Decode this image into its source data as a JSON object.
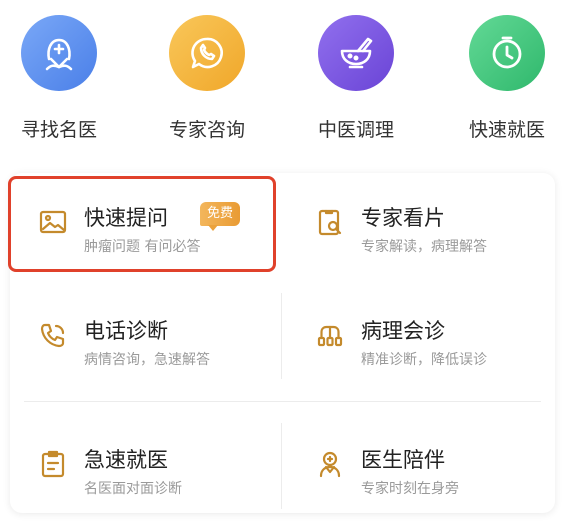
{
  "top_nav": [
    {
      "label": "寻找名医",
      "icon": "find-doctor-icon",
      "color": "#5b8ff1"
    },
    {
      "label": "专家咨询",
      "icon": "expert-consult-icon",
      "color": "#f5b63c"
    },
    {
      "label": "中医调理",
      "icon": "tcm-icon",
      "color": "#7b56e0"
    },
    {
      "label": "快速就医",
      "icon": "clock-icon",
      "color": "#3cc67a"
    }
  ],
  "services": [
    {
      "title": "快速提问",
      "subtitle": "肿瘤问题 有问必答",
      "badge": "免费",
      "icon": "picture-icon"
    },
    {
      "title": "专家看片",
      "subtitle": "专家解读，病理解答",
      "icon": "film-review-icon"
    },
    {
      "title": "电话诊断",
      "subtitle": "病情咨询，急速解答",
      "icon": "phone-icon"
    },
    {
      "title": "病理会诊",
      "subtitle": "精准诊断，降低误诊",
      "icon": "consultation-icon"
    },
    {
      "title": "急速就医",
      "subtitle": "名医面对面诊断",
      "icon": "clipboard-icon"
    },
    {
      "title": "医生陪伴",
      "subtitle": "专家时刻在身旁",
      "icon": "doctor-companion-icon"
    }
  ],
  "accent_color": "#c48a2c",
  "highlight_color": "#e0412b"
}
